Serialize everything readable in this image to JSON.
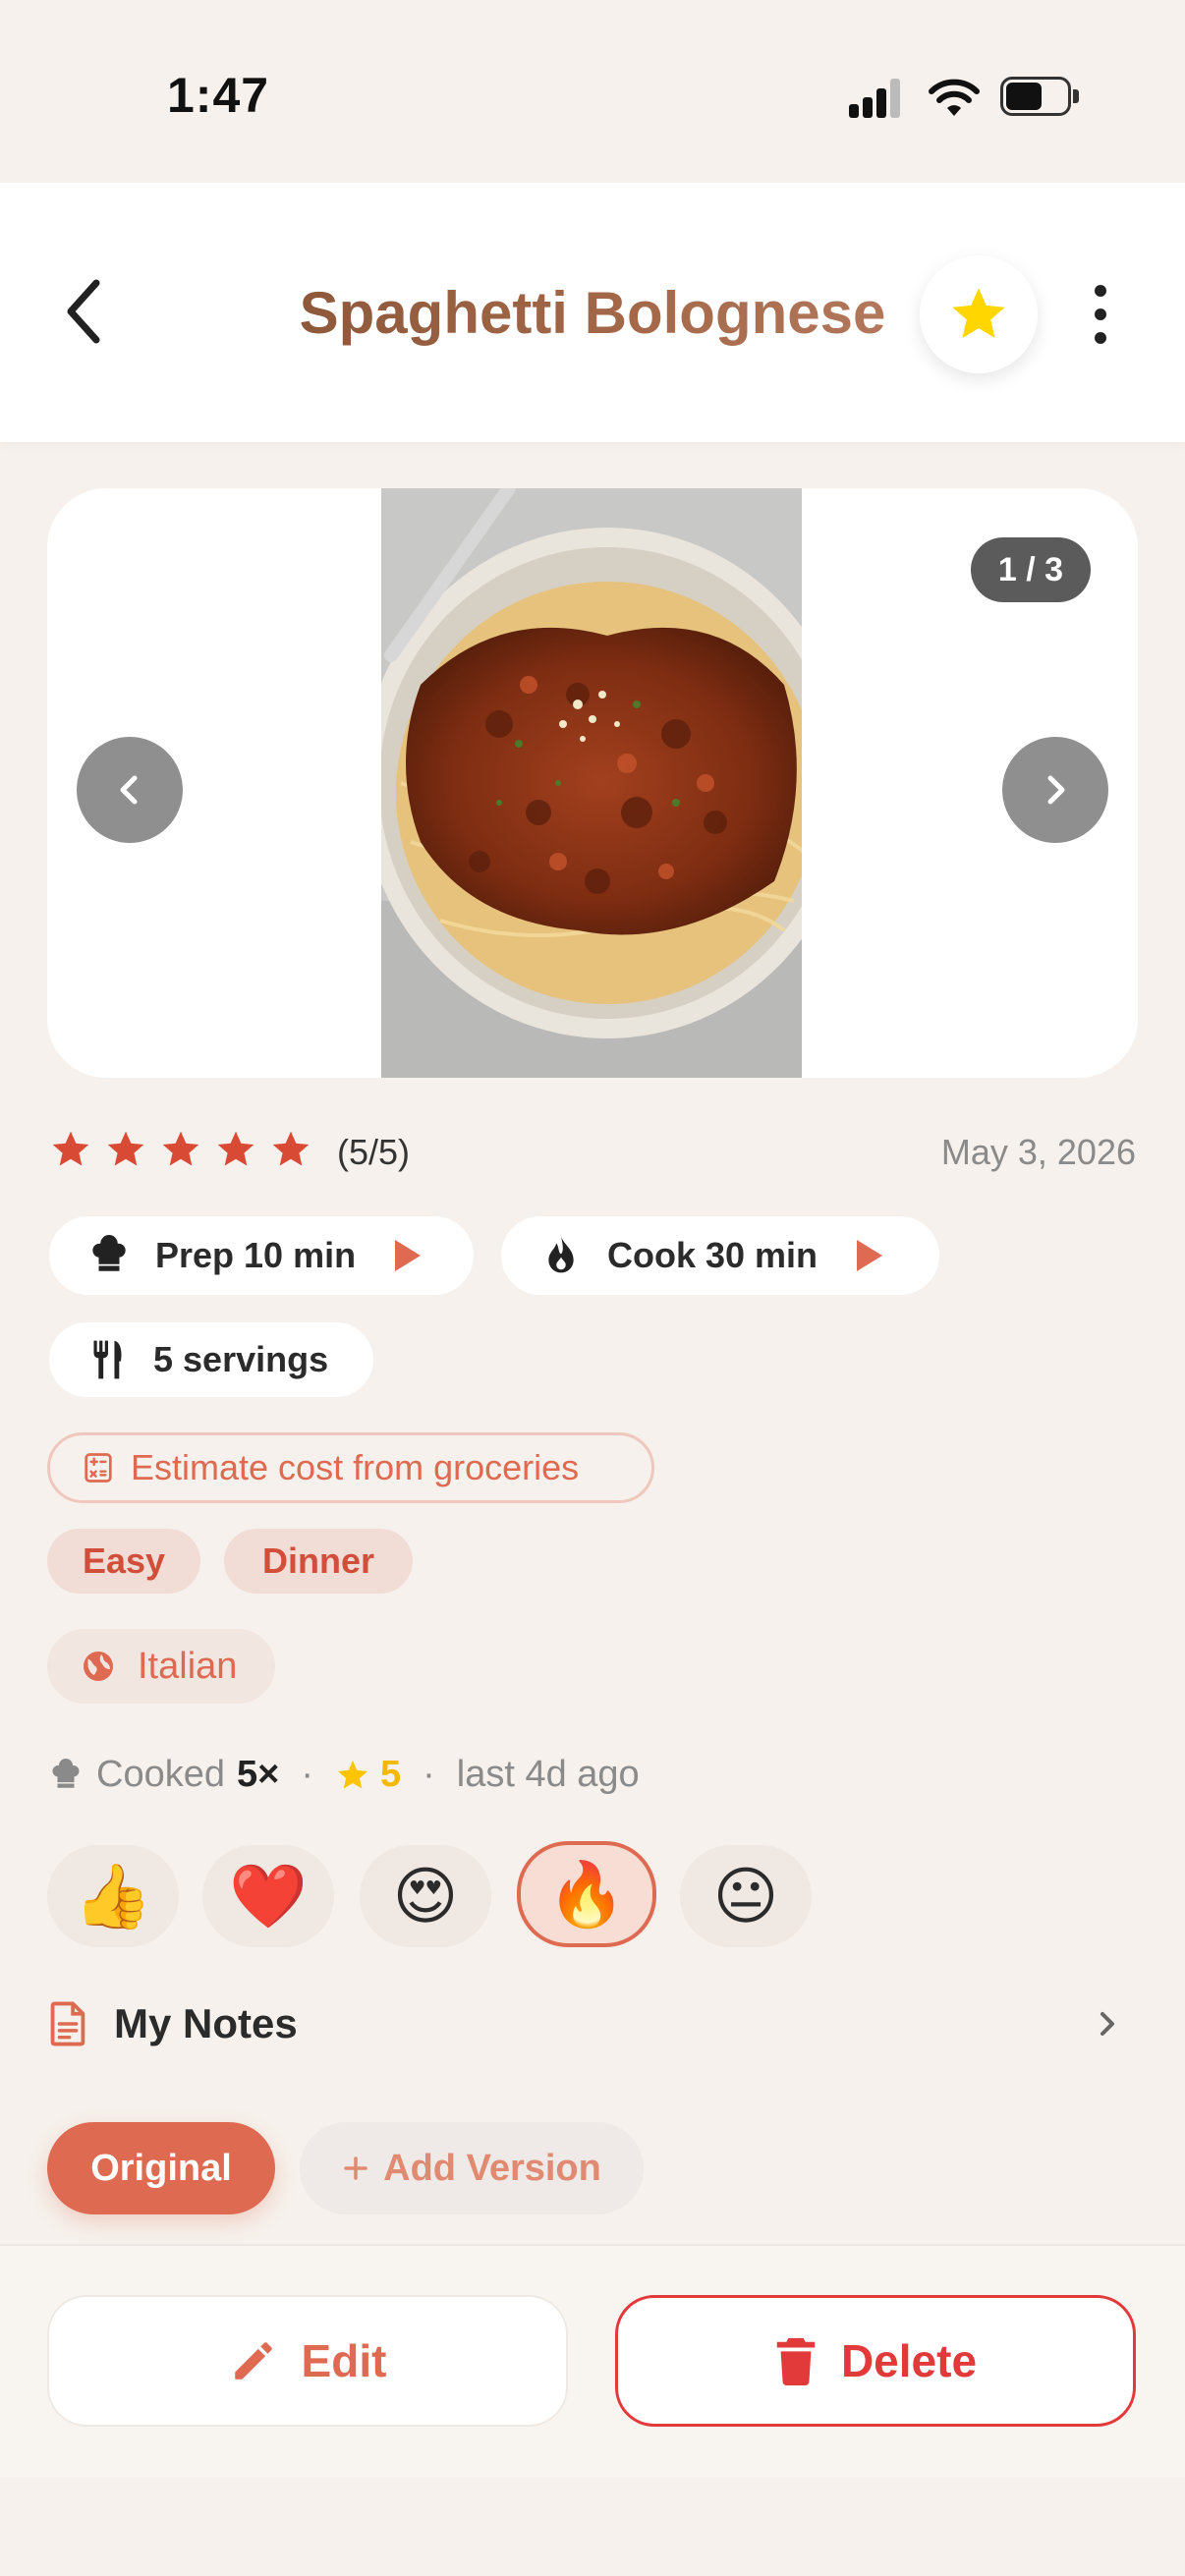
{
  "status_bar": {
    "time": "1:47"
  },
  "header": {
    "title": "Spaghetti Bolognese"
  },
  "gallery": {
    "counter": "1 / 3"
  },
  "rating": {
    "stars": 5,
    "text": "(5/5)",
    "date": "May 3, 2026"
  },
  "times": {
    "prep": "Prep 10 min",
    "cook": "Cook 30 min",
    "servings": "5 servings"
  },
  "estimate_cost_label": "Estimate cost from groceries",
  "tags": [
    "Easy",
    "Dinner"
  ],
  "cuisine": "Italian",
  "cooked": {
    "prefix": "Cooked",
    "count": "5×",
    "sep": "·",
    "rating": "5",
    "last": "last 4d ago"
  },
  "reactions": {
    "items": [
      "👍",
      "❤️",
      "😍",
      "🔥",
      "😐"
    ],
    "selected_index": 3
  },
  "notes": {
    "label": "My Notes"
  },
  "versions": {
    "active": "Original",
    "add_label": "Add Version"
  },
  "actions": {
    "edit": "Edit",
    "delete": "Delete"
  },
  "colors": {
    "accent": "#de6a52",
    "danger": "#e23a3a",
    "star": "#d94a35",
    "fav_star": "#ffd600"
  }
}
